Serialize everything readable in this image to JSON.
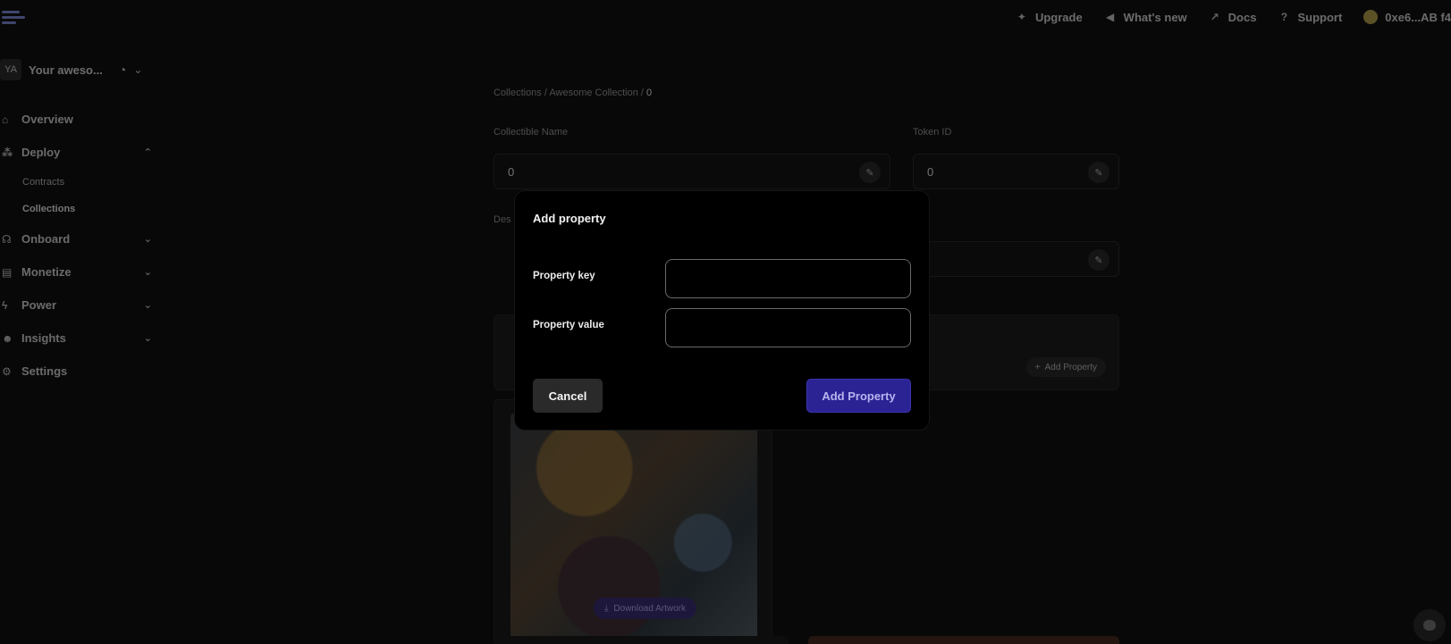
{
  "topnav": {
    "upgrade": "Upgrade",
    "whats_new": "What's new",
    "docs": "Docs",
    "support": "Support",
    "wallet": "0xe6...AB f4"
  },
  "sidebar": {
    "team_initials": "YA",
    "team_name": "Your aweso...",
    "items": [
      {
        "label": "Overview"
      },
      {
        "label": "Deploy"
      },
      {
        "label": "Contracts"
      },
      {
        "label": "Collections"
      },
      {
        "label": "Onboard"
      },
      {
        "label": "Monetize"
      },
      {
        "label": "Power"
      },
      {
        "label": "Insights"
      },
      {
        "label": "Settings"
      }
    ]
  },
  "main": {
    "breadcrumb_collections": "Collections",
    "breadcrumb_sep": " / ",
    "breadcrumb_collection": "Awesome Collection",
    "breadcrumb_current": "0",
    "collectible_name_label": "Collectible Name",
    "collectible_name_value": "0",
    "token_id_label": "Token ID",
    "token_id_value": "0",
    "description_label": "Des",
    "add_property_small": "Add Property",
    "download_artwork": "Download Artwork"
  },
  "modal": {
    "title": "Add property",
    "key_label": "Property key",
    "value_label": "Property value",
    "key_value": "",
    "value_value": "",
    "cancel_label": "Cancel",
    "add_label": "Add Property"
  },
  "colors": {
    "accent": "#2b2394",
    "background": "#101010",
    "modal_bg": "#000000"
  }
}
